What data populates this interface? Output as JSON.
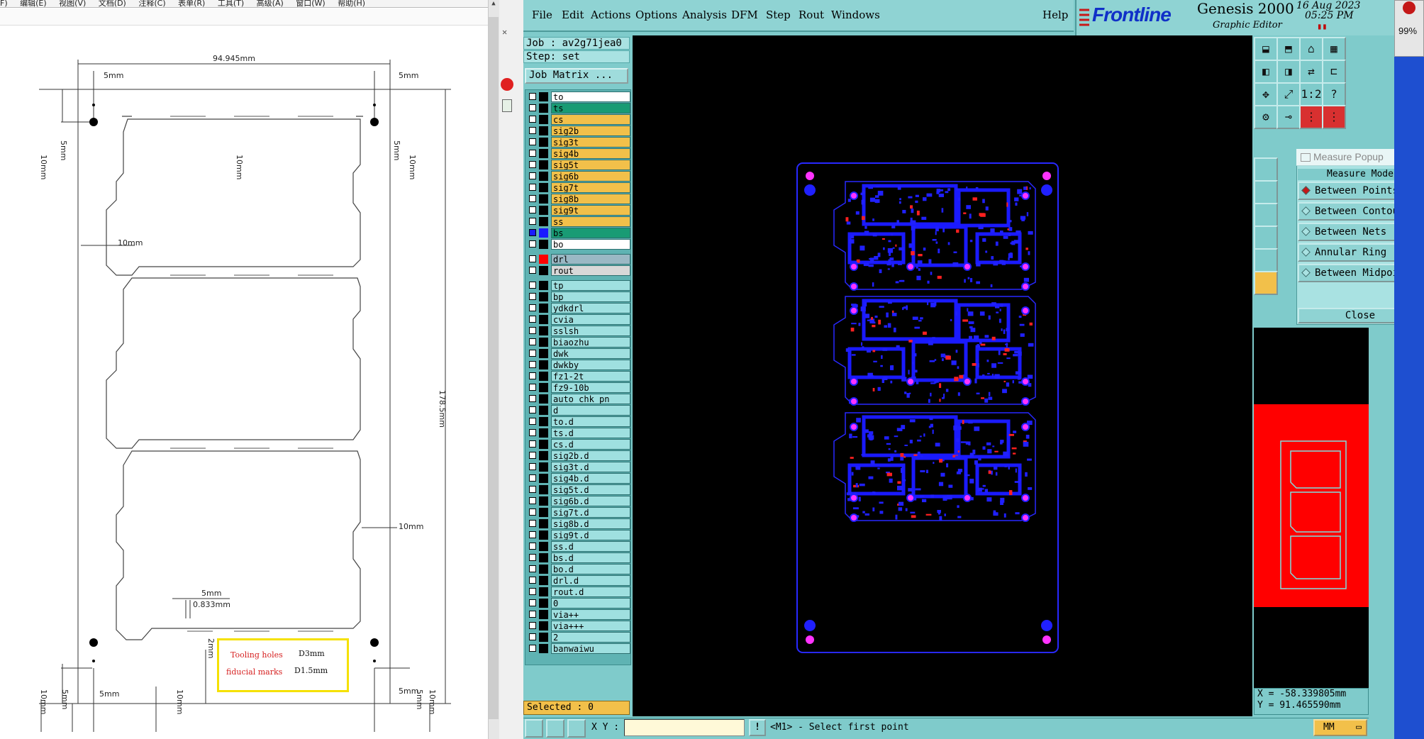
{
  "cad_viewer": {
    "menu": [
      "F)",
      "编辑(E)",
      "视图(V)",
      "文档(D)",
      "注释(C)",
      "表单(R)",
      "工具(T)",
      "高级(A)",
      "窗口(W)",
      "帮助(H)"
    ],
    "dimensions": {
      "width_total": "94.945mm",
      "height_total": "178.5mm",
      "margin_5mm": "5mm",
      "spacing_10mm": "10mm",
      "bridge_5mm": "5mm",
      "bridge_width": "0.833mm",
      "gap_2mm": "2mm"
    },
    "legend": {
      "tooling_holes_label": "Tooling holes",
      "tooling_holes_code": "D3mm",
      "fiducial_label": "fiducial marks",
      "fiducial_code": "D1.5mm"
    }
  },
  "genesis": {
    "menu": [
      "File",
      "Edit",
      "Actions",
      "Options",
      "Analysis",
      "DFM",
      "Step",
      "Rout",
      "Windows"
    ],
    "help_label": "Help",
    "brand": {
      "logo": "Frontline",
      "title": "Genesis 2000",
      "subtitle": "Graphic Editor",
      "date": "16 Aug 2023",
      "time": "05:25 PM",
      "pause_icon": "pause-icon"
    },
    "job_line": "Job : av2g71jea0",
    "step_line": "Step: set",
    "job_matrix_label": "Job Matrix ...",
    "layers": [
      {
        "name": "to",
        "color": "#ffffff",
        "swatch": "#000000"
      },
      {
        "name": "ts",
        "color": "#199b74",
        "swatch": "#000000"
      },
      {
        "name": "cs",
        "color": "#f2c04a",
        "swatch": "#000000"
      },
      {
        "name": "sig2b",
        "color": "#f2c04a",
        "swatch": "#000000"
      },
      {
        "name": "sig3t",
        "color": "#f2c04a",
        "swatch": "#000000"
      },
      {
        "name": "sig4b",
        "color": "#f2c04a",
        "swatch": "#000000"
      },
      {
        "name": "sig5t",
        "color": "#f2c04a",
        "swatch": "#000000"
      },
      {
        "name": "sig6b",
        "color": "#f2c04a",
        "swatch": "#000000"
      },
      {
        "name": "sig7t",
        "color": "#f2c04a",
        "swatch": "#000000"
      },
      {
        "name": "sig8b",
        "color": "#f2c04a",
        "swatch": "#000000"
      },
      {
        "name": "sig9t",
        "color": "#f2c04a",
        "swatch": "#000000"
      },
      {
        "name": "ss",
        "color": "#f2c04a",
        "swatch": "#000000"
      },
      {
        "name": "bs",
        "color": "#199b74",
        "swatch": "#1a1aff",
        "active": true
      },
      {
        "name": "bo",
        "color": "#ffffff",
        "swatch": "#000000"
      },
      {
        "name": "drl",
        "color": "#9ab8c4",
        "swatch": "#ff0000"
      },
      {
        "name": "rout",
        "color": "#d8d8d8",
        "swatch": "#000000"
      },
      {
        "name": "tp",
        "color": "#9fe0e0",
        "swatch": "#000000"
      },
      {
        "name": "bp",
        "color": "#9fe0e0",
        "swatch": "#000000"
      },
      {
        "name": "ydkdrl",
        "color": "#9fe0e0",
        "swatch": "#000000"
      },
      {
        "name": "cvia",
        "color": "#9fe0e0",
        "swatch": "#000000"
      },
      {
        "name": "sslsh",
        "color": "#9fe0e0",
        "swatch": "#000000"
      },
      {
        "name": "biaozhu",
        "color": "#9fe0e0",
        "swatch": "#000000"
      },
      {
        "name": "dwk",
        "color": "#9fe0e0",
        "swatch": "#000000"
      },
      {
        "name": "dwkby",
        "color": "#9fe0e0",
        "swatch": "#000000"
      },
      {
        "name": "fz1-2t",
        "color": "#9fe0e0",
        "swatch": "#000000"
      },
      {
        "name": "fz9-10b",
        "color": "#9fe0e0",
        "swatch": "#000000"
      },
      {
        "name": "auto_chk_pn",
        "color": "#9fe0e0",
        "swatch": "#000000"
      },
      {
        "name": "d",
        "color": "#9fe0e0",
        "swatch": "#000000"
      },
      {
        "name": "to.d",
        "color": "#9fe0e0",
        "swatch": "#000000"
      },
      {
        "name": "ts.d",
        "color": "#9fe0e0",
        "swatch": "#000000"
      },
      {
        "name": "cs.d",
        "color": "#9fe0e0",
        "swatch": "#000000"
      },
      {
        "name": "sig2b.d",
        "color": "#9fe0e0",
        "swatch": "#000000"
      },
      {
        "name": "sig3t.d",
        "color": "#9fe0e0",
        "swatch": "#000000"
      },
      {
        "name": "sig4b.d",
        "color": "#9fe0e0",
        "swatch": "#000000"
      },
      {
        "name": "sig5t.d",
        "color": "#9fe0e0",
        "swatch": "#000000"
      },
      {
        "name": "sig6b.d",
        "color": "#9fe0e0",
        "swatch": "#000000"
      },
      {
        "name": "sig7t.d",
        "color": "#9fe0e0",
        "swatch": "#000000"
      },
      {
        "name": "sig8b.d",
        "color": "#9fe0e0",
        "swatch": "#000000"
      },
      {
        "name": "sig9t.d",
        "color": "#9fe0e0",
        "swatch": "#000000"
      },
      {
        "name": "ss.d",
        "color": "#9fe0e0",
        "swatch": "#000000"
      },
      {
        "name": "bs.d",
        "color": "#9fe0e0",
        "swatch": "#000000"
      },
      {
        "name": "bo.d",
        "color": "#9fe0e0",
        "swatch": "#000000"
      },
      {
        "name": "drl.d",
        "color": "#9fe0e0",
        "swatch": "#000000"
      },
      {
        "name": "rout.d",
        "color": "#9fe0e0",
        "swatch": "#000000"
      },
      {
        "name": "0",
        "color": "#9fe0e0",
        "swatch": "#000000"
      },
      {
        "name": "via++",
        "color": "#9fe0e0",
        "swatch": "#000000"
      },
      {
        "name": "via+++",
        "color": "#9fe0e0",
        "swatch": "#000000"
      },
      {
        "name": "2",
        "color": "#9fe0e0",
        "swatch": "#000000"
      },
      {
        "name": "banwaiwu",
        "color": "#9fe0e0",
        "swatch": "#000000"
      }
    ],
    "selected_label": "Selected : 0",
    "measure_popup": {
      "title": "Measure Popup",
      "mode_label": "Measure Mode",
      "options": [
        "Between Points",
        "Between Contours",
        "Between Nets",
        "Annular Ring",
        "Between Midpoints"
      ],
      "selected_option": "Between Points",
      "close_label": "Close"
    },
    "tools": {
      "row1": [
        "zoom-home-icon",
        "zoom-fit-icon",
        "home-icon",
        "window-icon"
      ],
      "row2": [
        "pan-left-icon",
        "pan-right-icon",
        "swap-icon",
        "step-icon"
      ],
      "row3": [
        "zoom-in-icon",
        "zoom-area-icon",
        "ratio-1-2-icon",
        "help-icon"
      ],
      "row4": [
        "snap-icon",
        "probe-icon",
        "layers-a-icon",
        "layers-b-icon"
      ],
      "ratio_label": "1:2",
      "help_label": "?"
    },
    "coords": {
      "x": "X = -58.339805mm",
      "y": "Y = 91.465590mm"
    },
    "status": {
      "xy_label": "X Y :",
      "bang": "!",
      "prompt": "<M1> - Select first point",
      "units": "MM"
    },
    "accent": {
      "panel": "#7fcbcb",
      "canvas": "#000000",
      "copper": "#1a1aff",
      "pad": "#ff33ff",
      "mini_bg": "#ff0000"
    }
  },
  "system": {
    "zoom": "99%"
  }
}
